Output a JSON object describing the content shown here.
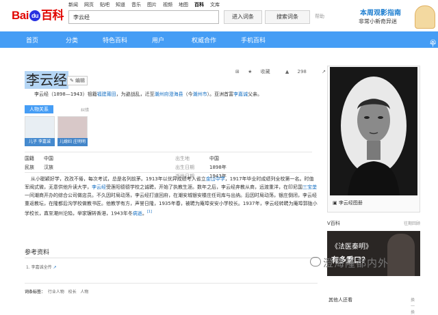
{
  "header": {
    "logo_left": "Bai",
    "logo_paw": "du",
    "logo_right": "百科",
    "navlinks": [
      "新闻",
      "网页",
      "贴吧",
      "知道",
      "音乐",
      "图片",
      "视频",
      "地图",
      "百科",
      "文库"
    ],
    "search_value": "李云经",
    "enter_btn": "进入词条",
    "search_btn": "搜索词条",
    "help": "帮助",
    "promo_line1": "本周观影指南",
    "promo_line2": "非常小新奇异迷"
  },
  "mainnav": {
    "items": [
      "首页",
      "分类",
      "特色百科",
      "用户",
      "权威合作",
      "手机百科"
    ],
    "user": "个人中心"
  },
  "article": {
    "title": "李云经",
    "edit": "编辑",
    "tools": [
      "收藏",
      "298",
      "1"
    ],
    "summary_pre": "李云经（1898—1943）祖籍",
    "summary_l1": "福建",
    "summary_l2": "莆田",
    "summary_mid": "，为避战乱，迁至",
    "summary_l3": "潮州府",
    "summary_l4": "澄海县",
    "summary_paren": "（今",
    "summary_l5": "潮州市",
    "summary_end": "）。亚洲首富",
    "summary_l6": "李嘉诚",
    "summary_tail": "父亲。",
    "relation_tag": "人物关系",
    "relation_edit": "纠错",
    "rel1_label": "儿子 李嘉诚",
    "rel2_label": "儿媳妇 庄明明"
  },
  "infobox": {
    "rows": [
      {
        "k1": "国籍",
        "v1": "中国",
        "k2": "出生地",
        "v2": "中国"
      },
      {
        "k1": "民族",
        "v1": "汉族",
        "k2": "出生日期",
        "v2": "1898年"
      },
      {
        "k1": "",
        "v1": "",
        "k2": "逝世日期",
        "v2": "1943年"
      }
    ]
  },
  "body": {
    "p_a": "从小聪颖好学，孜孜不倦，每次考试，总是名列前茅。1913年以优异成绩考入省立",
    "p_link1": "金山中学",
    "p_b": "，1917年毕业时成绩列全校第一名。时值军阀式微，无意供他升读大学，",
    "p_link2": "李云经",
    "p_c": "受莲阳德德学校之诚聘，开始了执教生涯。数年之后，李云经弃教从商，远渡重洋，在印尼国",
    "p_link3": "三宝垄",
    "p_d": "一间潮商开办的综合公司做店员。不久因时局动荡，李云经打道回府，在潮安城银安楼庄任司库与出纳。后因时局动荡，银庄倒闭，李云经重返教坛，在隆都后沟学校做教书匠。他教学有方，声誉日隆，1935年春，被聘为庵埠安安小学校长。1937年，李云经转聘为庵埠郭陇小学校长，直至潮州沦陷，举家辗转香港，1943年冬",
    "p_link4": "病逝",
    "p_e": "。",
    "p_ref": "[1]",
    "ref_heading": "参考资料",
    "ref_item": "1.  李嘉诚全传",
    "tags_label": "词条标签：",
    "tags": [
      "行业人物",
      "校长",
      "人物"
    ]
  },
  "sidebar": {
    "photo_caption": "李云经图册",
    "vbaike": "V百科",
    "vbaike_more": "往期回顾",
    "movie_title": "《法医秦明》",
    "movie_sub": "有多重口？",
    "watermark": "澄海隆都内外",
    "others": "其他人还看",
    "others_more": "换一换"
  }
}
